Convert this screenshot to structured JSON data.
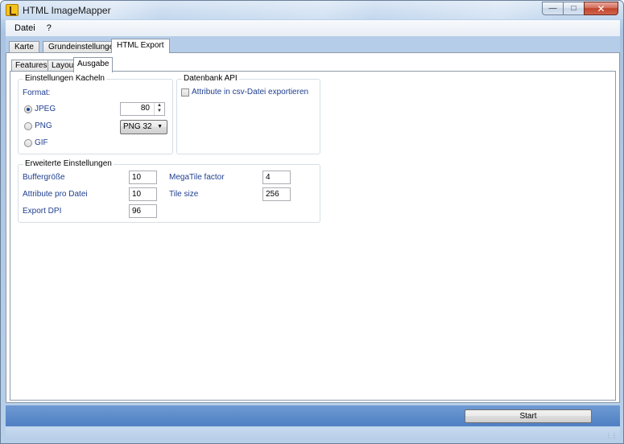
{
  "window": {
    "title": "HTML ImageMapper"
  },
  "menu": [
    "Datei",
    "?"
  ],
  "main_tabs": [
    {
      "label": "Karte"
    },
    {
      "label": "Grundeinstellungen"
    },
    {
      "label": "HTML Export",
      "active": true
    }
  ],
  "sub_tabs": [
    {
      "label": "Features"
    },
    {
      "label": "Layout"
    },
    {
      "label": "Ausgabe",
      "active": true
    }
  ],
  "tiles": {
    "legend": "Einstellungen Kacheln",
    "format_label": "Format:",
    "options": [
      "JPEG",
      "PNG",
      "GIF"
    ],
    "selected": "JPEG",
    "jpeg_quality": "80",
    "png_type": "PNG 32"
  },
  "database": {
    "legend": "Datenbank API",
    "csv_label": "Attribute in csv-Datei exportieren",
    "csv_checked": false
  },
  "advanced": {
    "legend": "Erweiterte Einstellungen",
    "buffer_label": "Buffergröße",
    "buffer_value": "10",
    "attrs_label": "Attribute pro Datei",
    "attrs_value": "10",
    "dpi_label": "Export DPI",
    "dpi_value": "96",
    "megatile_label": "MegaTile factor",
    "megatile_value": "4",
    "tilesize_label": "Tile size",
    "tilesize_value": "256"
  },
  "footer": {
    "start_label": "Start"
  },
  "icons": {
    "app": "hand-pointer-icon",
    "minimize": "minimize-icon",
    "maximize": "maximize-icon",
    "close": "close-icon"
  }
}
